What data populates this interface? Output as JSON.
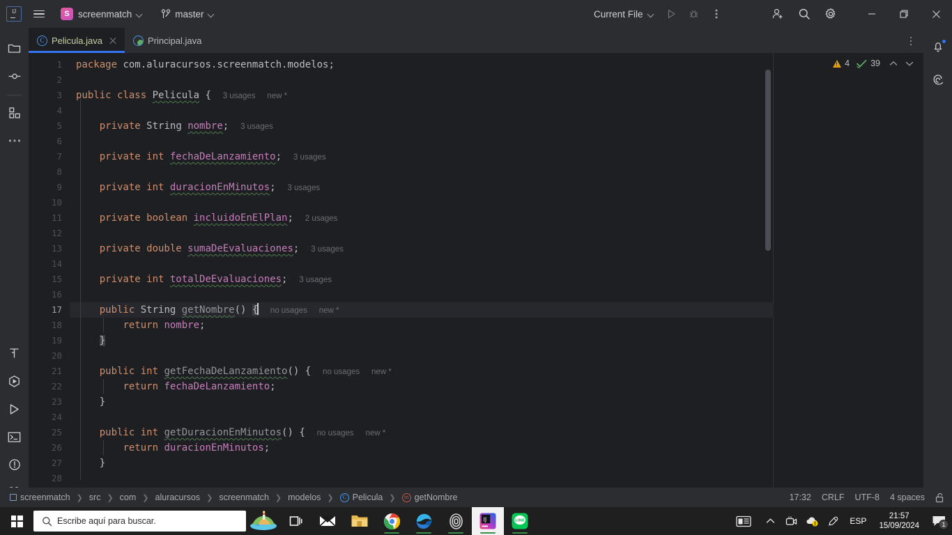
{
  "titlebar": {
    "logo_text": "IJ",
    "project_badge": "S",
    "project_name": "screenmatch",
    "branch_name": "master",
    "run_config": "Current File",
    "icons": {
      "hamburger": "hamburger-icon",
      "run": "run-icon",
      "debug": "debug-icon",
      "more": "more-options-icon",
      "code_with_me": "code-with-me-icon",
      "search": "search-icon",
      "settings": "gear-icon",
      "minimize": "minimize-icon",
      "maximize": "maximize-icon",
      "close": "close-icon"
    }
  },
  "left_toolbar": {
    "top_items": [
      {
        "name": "project",
        "icon": "folder-icon"
      },
      {
        "name": "commit",
        "icon": "commit-icon"
      }
    ],
    "after_divider": [
      {
        "name": "structure",
        "icon": "structure-icon"
      },
      {
        "name": "more-tool-windows",
        "icon": "more-dots-icon"
      }
    ],
    "bottom_items": [
      {
        "name": "build",
        "icon": "hammer-icon"
      },
      {
        "name": "services",
        "icon": "services-icon"
      },
      {
        "name": "run",
        "icon": "run-triangle-icon"
      },
      {
        "name": "terminal",
        "icon": "terminal-icon"
      },
      {
        "name": "problems",
        "icon": "warning-circle-icon"
      },
      {
        "name": "version-control",
        "icon": "git-branch-icon"
      }
    ]
  },
  "right_toolbar": {
    "items": [
      {
        "name": "notifications",
        "icon": "bell-icon",
        "has_badge": true
      },
      {
        "name": "ai-assistant",
        "icon": "spiral-icon",
        "has_badge": false
      }
    ]
  },
  "tabs": [
    {
      "label": "Pelicula.java",
      "icon": "java-class-icon",
      "active": true,
      "closable": true
    },
    {
      "label": "Principal.java",
      "icon": "java-main-class-icon",
      "active": false,
      "closable": false
    }
  ],
  "editor": {
    "inspection": {
      "warning_count": "4",
      "ok_count": "39",
      "prev_icon": "chevron-up-icon",
      "next_icon": "chevron-down-icon"
    },
    "current_line": 17,
    "lines": [
      {
        "n": 1,
        "code": "package com.aluracursos.screenmatch.modelos;"
      },
      {
        "n": 2,
        "code": ""
      },
      {
        "n": 3,
        "code": "public class Pelicula {",
        "hint": "3 usages",
        "hint2": "new *"
      },
      {
        "n": 4,
        "code": ""
      },
      {
        "n": 5,
        "code": "    private String nombre;",
        "hint": "3 usages"
      },
      {
        "n": 6,
        "code": ""
      },
      {
        "n": 7,
        "code": "    private int fechaDeLanzamiento;",
        "hint": "3 usages"
      },
      {
        "n": 8,
        "code": ""
      },
      {
        "n": 9,
        "code": "    private int duracionEnMinutos;",
        "hint": "3 usages"
      },
      {
        "n": 10,
        "code": ""
      },
      {
        "n": 11,
        "code": "    private boolean incluidoEnElPlan;",
        "hint": "2 usages"
      },
      {
        "n": 12,
        "code": ""
      },
      {
        "n": 13,
        "code": "    private double sumaDeEvaluaciones;",
        "hint": "3 usages"
      },
      {
        "n": 14,
        "code": ""
      },
      {
        "n": 15,
        "code": "    private int totalDeEvaluaciones;",
        "hint": "3 usages"
      },
      {
        "n": 16,
        "code": ""
      },
      {
        "n": 17,
        "code": "    public String getNombre() {",
        "hint": "no usages",
        "hint2": "new *"
      },
      {
        "n": 18,
        "code": "        return nombre;"
      },
      {
        "n": 19,
        "code": "    }"
      },
      {
        "n": 20,
        "code": ""
      },
      {
        "n": 21,
        "code": "    public int getFechaDeLanzamiento() {",
        "hint": "no usages",
        "hint2": "new *"
      },
      {
        "n": 22,
        "code": "        return fechaDeLanzamiento;"
      },
      {
        "n": 23,
        "code": "    }"
      },
      {
        "n": 24,
        "code": ""
      },
      {
        "n": 25,
        "code": "    public int getDuracionEnMinutos() {",
        "hint": "no usages",
        "hint2": "new *"
      },
      {
        "n": 26,
        "code": "        return duracionEnMinutos;"
      },
      {
        "n": 27,
        "code": "    }"
      },
      {
        "n": 28,
        "code": ""
      }
    ]
  },
  "breadcrumb": [
    {
      "label": "screenmatch",
      "icon": "module-icon"
    },
    {
      "label": "src",
      "icon": ""
    },
    {
      "label": "com",
      "icon": ""
    },
    {
      "label": "aluracursos",
      "icon": ""
    },
    {
      "label": "screenmatch",
      "icon": ""
    },
    {
      "label": "modelos",
      "icon": ""
    },
    {
      "label": "Pelicula",
      "icon": "class-icon"
    },
    {
      "label": "getNombre",
      "icon": "method-icon"
    }
  ],
  "status_bar": {
    "position": "17:32",
    "line_separator": "CRLF",
    "encoding": "UTF-8",
    "indent": "4 spaces",
    "lock_icon": "unlocked-icon"
  },
  "taskbar": {
    "start_icon": "windows-logo-icon",
    "search_placeholder": "Escribe aquí para buscar.",
    "search_icon": "search-icon",
    "apps": [
      {
        "name": "weather-widget",
        "icon": "weather-island-icon",
        "running": false,
        "active": false
      },
      {
        "name": "task-view",
        "icon": "task-view-icon",
        "running": false,
        "active": false
      },
      {
        "name": "mail",
        "icon": "mail-icon",
        "running": false,
        "active": false
      },
      {
        "name": "file-explorer",
        "icon": "folder-icon",
        "running": false,
        "active": false
      },
      {
        "name": "google-chrome",
        "icon": "chrome-icon",
        "running": true,
        "active": false
      },
      {
        "name": "microsoft-edge",
        "icon": "edge-icon",
        "running": true,
        "active": false
      },
      {
        "name": "recorder",
        "icon": "spiral-oval-icon",
        "running": true,
        "active": false
      },
      {
        "name": "intellij-idea",
        "icon": "intellij-icon",
        "running": true,
        "active": true
      },
      {
        "name": "line",
        "icon": "line-icon",
        "running": true,
        "active": false
      }
    ],
    "tray": {
      "news_icon": "news-weather-icon",
      "overflow_icon": "chevron-up-icon",
      "camera_icon": "camera-icon",
      "cloud_icon": "cloud-warning-icon",
      "pen_icon": "pen-icon",
      "language": "ESP",
      "time": "21:57",
      "date": "15/09/2024",
      "notification_icon": "notification-icon",
      "notification_count": "1"
    }
  },
  "colors": {
    "accent_blue": "#3574F0",
    "keyword": "#CF8E6D",
    "field": "#C77DBB",
    "text": "#BCBEC4",
    "editor_bg": "#1E1F22",
    "chrome_bg": "#2B2D30",
    "warning": "#E3A008",
    "ok_green": "#5FAD65"
  }
}
